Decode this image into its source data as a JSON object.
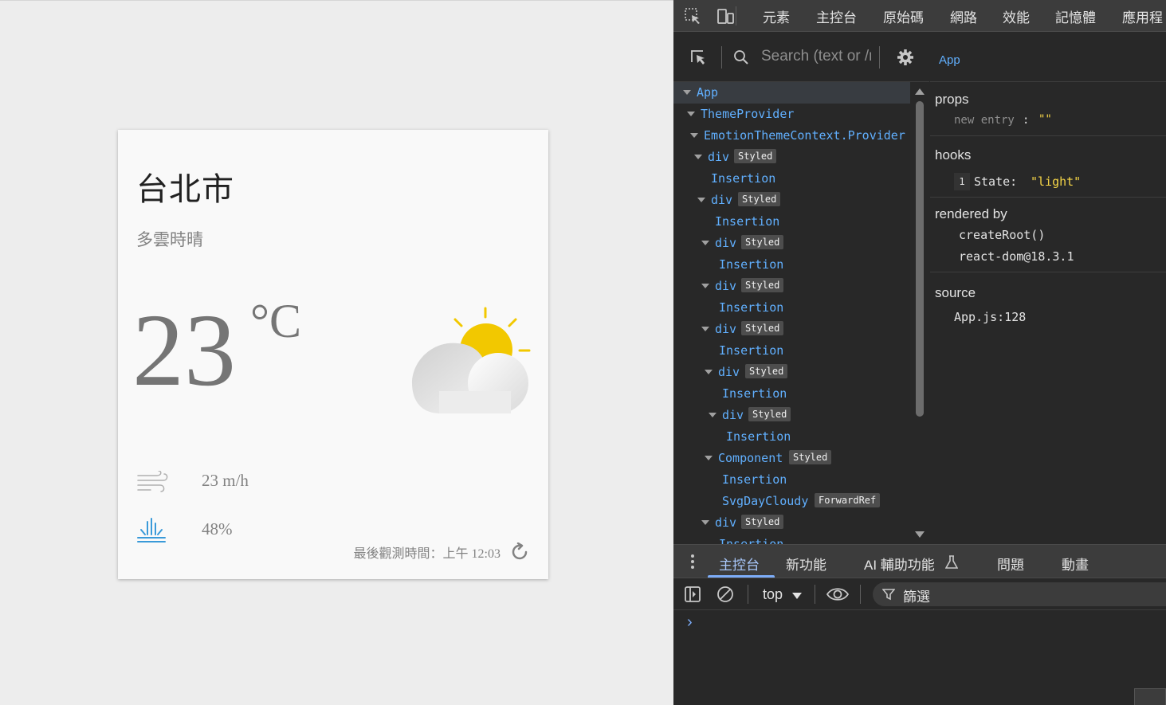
{
  "weather": {
    "city": "台北市",
    "description": "多雲時晴",
    "temperature": "23",
    "unit": "°C",
    "wind": "23 m/h",
    "rain": "48%",
    "observation": "最後觀測時間：上午 12:03",
    "colors": {
      "sun": "#f2c800",
      "cloud": "#e6e6e6",
      "text": "#757575",
      "rain_icon": "#3a9ad9"
    }
  },
  "devtools": {
    "tabs": [
      "元素",
      "主控台",
      "原始碼",
      "網路",
      "效能",
      "記憶體",
      "應用程"
    ],
    "search_placeholder": "Search (text or /regex/)",
    "tree": [
      {
        "name": "App",
        "badge": ""
      },
      {
        "name": "ThemeProvider",
        "badge": ""
      },
      {
        "name": "EmotionThemeContext.Provider",
        "badge": ""
      },
      {
        "name": "div",
        "badge": "Styled"
      },
      {
        "name": "Insertion",
        "badge": ""
      },
      {
        "name": "div",
        "badge": "Styled"
      },
      {
        "name": "Insertion",
        "badge": ""
      },
      {
        "name": "div",
        "badge": "Styled"
      },
      {
        "name": "Insertion",
        "badge": ""
      },
      {
        "name": "div",
        "badge": "Styled"
      },
      {
        "name": "Insertion",
        "badge": ""
      },
      {
        "name": "div",
        "badge": "Styled"
      },
      {
        "name": "Insertion",
        "badge": ""
      },
      {
        "name": "div",
        "badge": "Styled"
      },
      {
        "name": "Insertion",
        "badge": ""
      },
      {
        "name": "div",
        "badge": "Styled"
      },
      {
        "name": "Insertion",
        "badge": ""
      },
      {
        "name": "Component",
        "badge": "Styled"
      },
      {
        "name": "Insertion",
        "badge": ""
      },
      {
        "name": "SvgDayCloudy",
        "badge": "ForwardRef"
      },
      {
        "name": "div",
        "badge": "Styled"
      },
      {
        "name": "Insertion",
        "badge": ""
      }
    ],
    "selected_component": "App",
    "props": {
      "title": "props",
      "new_entry_key": "new entry",
      "new_entry_value": "\"\""
    },
    "hooks": {
      "title": "hooks",
      "index": "1",
      "key": "State:",
      "value": "\"light\""
    },
    "rendered_by": {
      "title": "rendered by",
      "items": [
        "createRoot()",
        "react-dom@18.3.1"
      ]
    },
    "source": {
      "title": "source",
      "file": "App.js:128"
    },
    "drawer_tabs": [
      "主控台",
      "新功能",
      "AI 輔助功能",
      "問題",
      "動畫"
    ],
    "console": {
      "context": "top",
      "filter_placeholder": "篩選",
      "prompt": "›"
    }
  }
}
